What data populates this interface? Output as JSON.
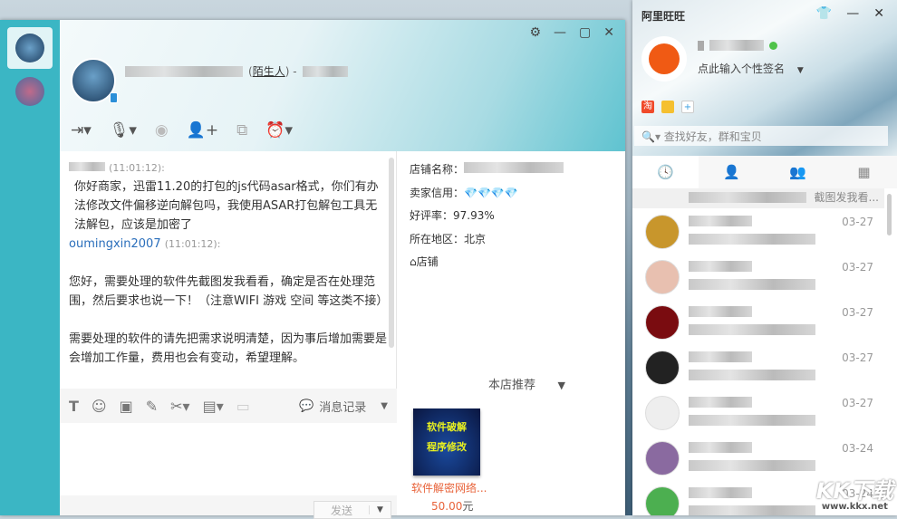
{
  "chat": {
    "window_buttons": [
      "⚙",
      "—",
      "▢",
      "✕"
    ],
    "contact_tag": "陌生人",
    "toolbar_icons": [
      "send-file-icon",
      "microphone-icon",
      "video-icon",
      "add-contact-icon",
      "remote-assist-icon",
      "alarm-icon"
    ],
    "messages": [
      {
        "time": "(11:01:12):",
        "text": "你好商家，迅雷11.20的打包的js代码asar格式，你们有办法修改文件偏移逆向解包吗，我使用ASAR打包解包工具无法解包，应该是加密了"
      },
      {
        "sender": "oumingxin2007",
        "time": "(11:01:12):",
        "paragraphs": [
          "您好，需要处理的软件先截图发我看看，确定是否在处理范围，然后要求也说一下！（注意WIFI 游戏 空间 等这类不接）",
          "需要处理的软件的请先把需求说明清楚，因为事后增加需要是会增加工作量，费用也会有变动，希望理解。"
        ]
      }
    ],
    "editor_icons": [
      "font-icon",
      "emoji-icon",
      "image-icon",
      "edit-icon",
      "scissors-icon",
      "calculator-icon",
      "screen-icon"
    ],
    "history_label": "消息记录",
    "send_label": "发送"
  },
  "shop": {
    "name_label": "店铺名称：",
    "credit_label": "卖家信用：",
    "rating": "好评率：97.93%",
    "region": "所在地区：北京",
    "shop_link": "店铺",
    "recommend_label": "本店推荐",
    "product": {
      "image_lines": [
        "软件破解",
        "程序修改"
      ],
      "title": "软件解密网络...",
      "price": "50.00",
      "currency": "元"
    }
  },
  "wangwang": {
    "title": "阿里旺旺",
    "window_buttons": [
      "👕",
      "—",
      "✕"
    ],
    "signature": "点此输入个性签名",
    "search_placeholder": "查找好友，群和宝贝",
    "tabs": [
      "recent-icon",
      "contacts-icon",
      "groups-icon",
      "apps-icon"
    ],
    "first_preview": "截图发我看...",
    "contacts": [
      {
        "date": "03-27",
        "color": "#c8962c"
      },
      {
        "date": "03-27",
        "color": "#e8c0b0"
      },
      {
        "date": "03-27",
        "color": "#7a0c10"
      },
      {
        "date": "03-27",
        "color": "#222"
      },
      {
        "date": "03-27",
        "color": "#eee"
      },
      {
        "date": "03-24",
        "color": "#8a6aa0"
      },
      {
        "date": "03-24",
        "color": "#4caf50"
      }
    ]
  },
  "watermark": {
    "big": "KK下载",
    "small": "www.kkx.net"
  }
}
